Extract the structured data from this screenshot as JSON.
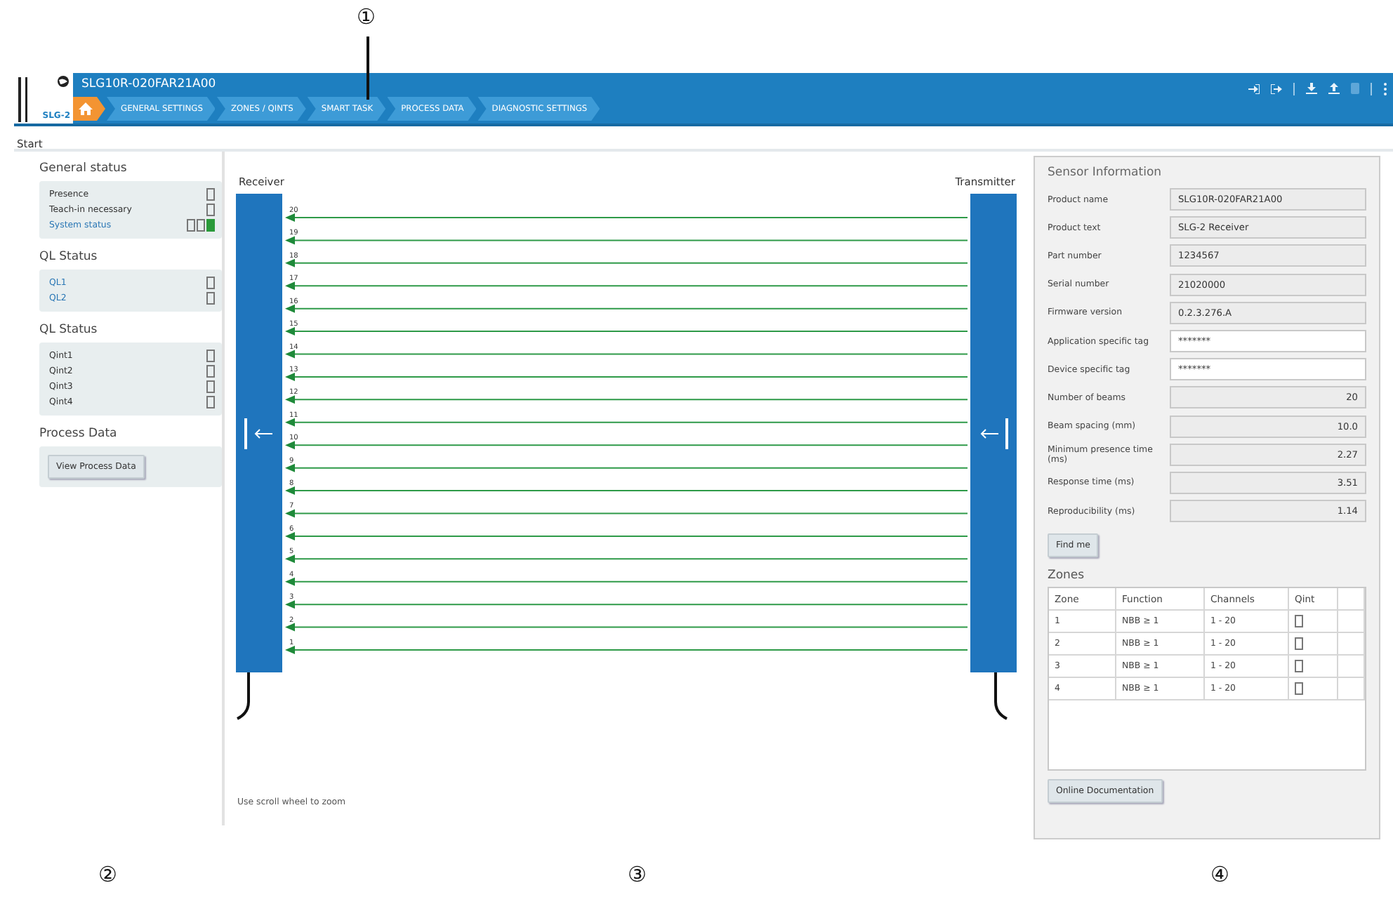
{
  "header": {
    "logo_text": "SLG-2",
    "title": "SLG10R-020FAR21A00",
    "tabs": [
      {
        "kind": "home",
        "selected": true
      },
      {
        "kind": "text",
        "label": "GENERAL SETTINGS",
        "selected": false
      },
      {
        "kind": "text",
        "label": "ZONES / QINTS",
        "selected": false
      },
      {
        "kind": "text",
        "label": "SMART TASK",
        "selected": false
      },
      {
        "kind": "text",
        "label": "PROCESS DATA",
        "selected": false
      },
      {
        "kind": "text",
        "label": "DIAGNOSTIC SETTINGS",
        "selected": false
      }
    ]
  },
  "breadcrumb": "Start",
  "status_panel": {
    "sections": [
      {
        "title": "General status",
        "kind": "lamps",
        "rows": [
          {
            "label": "Presence",
            "link": false,
            "lamps": [
              {
                "on": false
              }
            ]
          },
          {
            "label": "Teach-in necessary",
            "link": false,
            "lamps": [
              {
                "on": false
              }
            ]
          },
          {
            "label": "System status",
            "link": true,
            "lamps": [
              {
                "on": false
              },
              {
                "on": false
              },
              {
                "on": true
              }
            ]
          }
        ]
      },
      {
        "title": "QL Status",
        "kind": "lamps",
        "rows": [
          {
            "label": "QL1",
            "link": true,
            "lamps": [
              {
                "on": false
              }
            ]
          },
          {
            "label": "QL2",
            "link": true,
            "lamps": [
              {
                "on": false
              }
            ]
          }
        ]
      },
      {
        "title": "QL Status",
        "kind": "lamps",
        "rows": [
          {
            "label": "Qint1",
            "link": false,
            "lamps": [
              {
                "on": false
              }
            ]
          },
          {
            "label": "Qint2",
            "link": false,
            "lamps": [
              {
                "on": false
              }
            ]
          },
          {
            "label": "Qint3",
            "link": false,
            "lamps": [
              {
                "on": false
              }
            ]
          },
          {
            "label": "Qint4",
            "link": false,
            "lamps": [
              {
                "on": false
              }
            ]
          }
        ]
      },
      {
        "title": "Process Data",
        "kind": "button",
        "button": "View Process Data"
      }
    ]
  },
  "beam_view": {
    "receiver_label": "Receiver",
    "transmitter_label": "Transmitter",
    "beams": [
      {
        "number": "20"
      },
      {
        "number": "19"
      },
      {
        "number": "18"
      },
      {
        "number": "17"
      },
      {
        "number": "16"
      },
      {
        "number": "15"
      },
      {
        "number": "14"
      },
      {
        "number": "13"
      },
      {
        "number": "12"
      },
      {
        "number": "11"
      },
      {
        "number": "10"
      },
      {
        "number": "9"
      },
      {
        "number": "8"
      },
      {
        "number": "7"
      },
      {
        "number": "6"
      },
      {
        "number": "5"
      },
      {
        "number": "4"
      },
      {
        "number": "3"
      },
      {
        "number": "2"
      },
      {
        "number": "1"
      }
    ],
    "hint": "Use scroll wheel to zoom"
  },
  "sensor_info": {
    "title": "Sensor Information",
    "fields": [
      {
        "label": "Product name",
        "value": "SLG10R-020FAR21A00",
        "editable": false,
        "kind": "text"
      },
      {
        "label": "Product text",
        "value": "SLG-2 Receiver",
        "editable": false,
        "kind": "text"
      },
      {
        "label": "Part number",
        "value": "1234567",
        "editable": false,
        "kind": "text"
      },
      {
        "label": "Serial number",
        "value": "21020000",
        "editable": false,
        "kind": "text"
      },
      {
        "label": "Firmware version",
        "value": "0.2.3.276.A",
        "editable": false,
        "kind": "text"
      },
      {
        "label": "Application specific tag",
        "value": "*******",
        "editable": true,
        "kind": "text"
      },
      {
        "label": "Device specific tag",
        "value": "*******",
        "editable": true,
        "kind": "text"
      },
      {
        "label": "Number of beams",
        "value": "20",
        "editable": false,
        "kind": "number"
      },
      {
        "label": "Beam spacing (mm)",
        "value": "10.0",
        "editable": false,
        "kind": "number"
      },
      {
        "label": "Minimum presence time (ms)",
        "value": "2.27",
        "editable": false,
        "kind": "number"
      },
      {
        "label": "Response time (ms)",
        "value": "3.51",
        "editable": false,
        "kind": "number"
      },
      {
        "label": "Reproducibility (ms)",
        "value": "1.14",
        "editable": false,
        "kind": "number"
      }
    ],
    "find_button": "Find me",
    "zones": {
      "title": "Zones",
      "columns": [
        "Zone",
        "Function",
        "Channels",
        "Qint"
      ],
      "rows": [
        {
          "zone": "1",
          "function": "NBB ≥ 1",
          "channels": "1 - 20",
          "qint_on": false
        },
        {
          "zone": "2",
          "function": "NBB ≥ 1",
          "channels": "1 - 20",
          "qint_on": false
        },
        {
          "zone": "3",
          "function": "NBB ≥ 1",
          "channels": "1 - 20",
          "qint_on": false
        },
        {
          "zone": "4",
          "function": "NBB ≥ 1",
          "channels": "1 - 20",
          "qint_on": false
        }
      ]
    },
    "doc_button": "Online Documentation"
  },
  "callouts": [
    "①",
    "②",
    "③",
    "④"
  ]
}
